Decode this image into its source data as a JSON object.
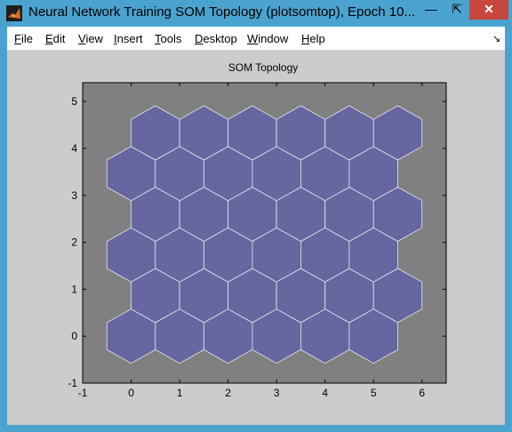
{
  "window": {
    "title": "Neural Network Training SOM Topology (plotsomtop), Epoch 10...",
    "minimize_glyph": "—",
    "restore_glyph": "⇱",
    "close_glyph": "✕"
  },
  "menu": {
    "items": [
      {
        "label": "File",
        "key": "F",
        "rest": "ile"
      },
      {
        "label": "Edit",
        "key": "E",
        "rest": "dit"
      },
      {
        "label": "View",
        "key": "V",
        "rest": "iew"
      },
      {
        "label": "Insert",
        "key": "I",
        "rest": "nsert"
      },
      {
        "label": "Tools",
        "key": "T",
        "rest": "ools"
      },
      {
        "label": "Desktop",
        "key": "D",
        "rest": "esktop"
      },
      {
        "label": "Window",
        "key": "W",
        "rest": "indow"
      },
      {
        "label": "Help",
        "key": "H",
        "rest": "elp"
      }
    ],
    "dock_glyph": "↘"
  },
  "colors": {
    "axes_background": "#808080",
    "figure_background": "#cccccc",
    "neuron_fill": "#6666a0",
    "neuron_edge": "#e8e8f2"
  },
  "chart_data": {
    "type": "hexagonal-topology",
    "title": "SOM Topology",
    "dimensions": [
      6,
      6
    ],
    "neurons": [
      {
        "x": 0,
        "y": 0
      },
      {
        "x": 1,
        "y": 0
      },
      {
        "x": 2,
        "y": 0
      },
      {
        "x": 3,
        "y": 0
      },
      {
        "x": 4,
        "y": 0
      },
      {
        "x": 5,
        "y": 0
      },
      {
        "x": 0.5,
        "y": 0.866
      },
      {
        "x": 1.5,
        "y": 0.866
      },
      {
        "x": 2.5,
        "y": 0.866
      },
      {
        "x": 3.5,
        "y": 0.866
      },
      {
        "x": 4.5,
        "y": 0.866
      },
      {
        "x": 5.5,
        "y": 0.866
      },
      {
        "x": 0,
        "y": 1.732
      },
      {
        "x": 1,
        "y": 1.732
      },
      {
        "x": 2,
        "y": 1.732
      },
      {
        "x": 3,
        "y": 1.732
      },
      {
        "x": 4,
        "y": 1.732
      },
      {
        "x": 5,
        "y": 1.732
      },
      {
        "x": 0.5,
        "y": 2.598
      },
      {
        "x": 1.5,
        "y": 2.598
      },
      {
        "x": 2.5,
        "y": 2.598
      },
      {
        "x": 3.5,
        "y": 2.598
      },
      {
        "x": 4.5,
        "y": 2.598
      },
      {
        "x": 5.5,
        "y": 2.598
      },
      {
        "x": 0,
        "y": 3.464
      },
      {
        "x": 1,
        "y": 3.464
      },
      {
        "x": 2,
        "y": 3.464
      },
      {
        "x": 3,
        "y": 3.464
      },
      {
        "x": 4,
        "y": 3.464
      },
      {
        "x": 5,
        "y": 3.464
      },
      {
        "x": 0.5,
        "y": 4.33
      },
      {
        "x": 1.5,
        "y": 4.33
      },
      {
        "x": 2.5,
        "y": 4.33
      },
      {
        "x": 3.5,
        "y": 4.33
      },
      {
        "x": 4.5,
        "y": 4.33
      },
      {
        "x": 5.5,
        "y": 4.33
      }
    ],
    "xlim": [
      -1,
      6.5
    ],
    "ylim": [
      -1,
      5.4
    ],
    "xticks": [
      -1,
      0,
      1,
      2,
      3,
      4,
      5,
      6
    ],
    "yticks": [
      -1,
      0,
      1,
      2,
      3,
      4,
      5
    ],
    "xlabel": "",
    "ylabel": "",
    "grid": false
  }
}
